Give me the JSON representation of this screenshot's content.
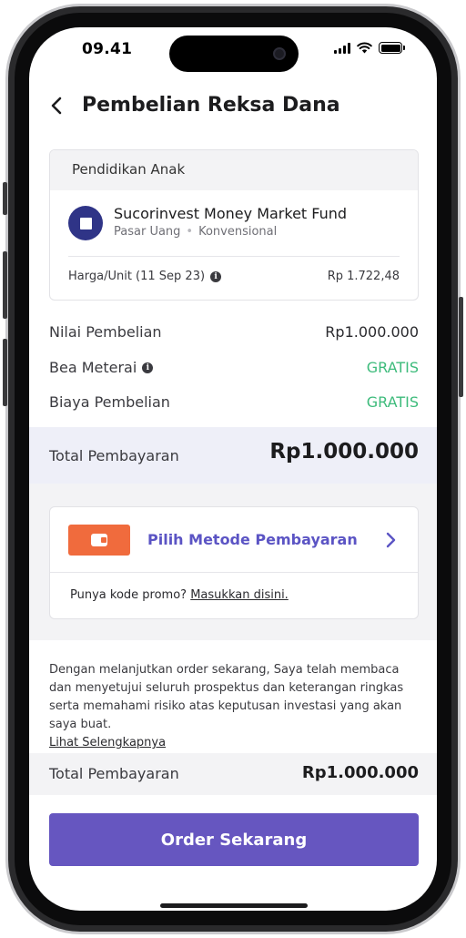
{
  "status_bar": {
    "time": "09.41"
  },
  "header": {
    "title": "Pembelian Reksa Dana"
  },
  "fund_card": {
    "goal": "Pendidikan Anak",
    "fund_name": "Sucorinvest Money Market Fund",
    "category": "Pasar Uang",
    "type": "Konvensional",
    "price_label": "Harga/Unit (11 Sep 23)",
    "price_value": "Rp 1.722,48"
  },
  "summary": {
    "purchase_label": "Nilai Pembelian",
    "purchase_value": "Rp1.000.000",
    "stamp_label": "Bea Meterai",
    "stamp_value": "GRATIS",
    "fee_label": "Biaya Pembelian",
    "fee_value": "GRATIS",
    "total_label": "Total Pembayaran",
    "total_value": "Rp1.000.000"
  },
  "payment": {
    "method_label": "Pilih Metode Pembayaran",
    "promo_text": "Punya kode promo?",
    "promo_link": "Masukkan disini."
  },
  "disclaimer": {
    "text": "Dengan melanjutkan order sekarang, Saya telah membaca dan menyetujui seluruh prospektus dan keterangan ringkas serta memahami risiko atas keputusan investasi yang akan saya buat.",
    "link": "Lihat Selengkapnya"
  },
  "footer": {
    "total_label": "Total Pembayaran",
    "total_value": "Rp1.000.000",
    "order_button": "Order Sekarang"
  },
  "colors": {
    "accent": "#6656c0",
    "link_purple": "#5b54c4",
    "free_green": "#3dbb7b",
    "wallet_orange": "#f06b3d",
    "fund_logo_navy": "#2f3487"
  },
  "icons": [
    "back-chevron-icon",
    "info-icon",
    "wallet-icon",
    "chevron-right-icon",
    "signal-icon",
    "wifi-icon",
    "battery-icon"
  ]
}
